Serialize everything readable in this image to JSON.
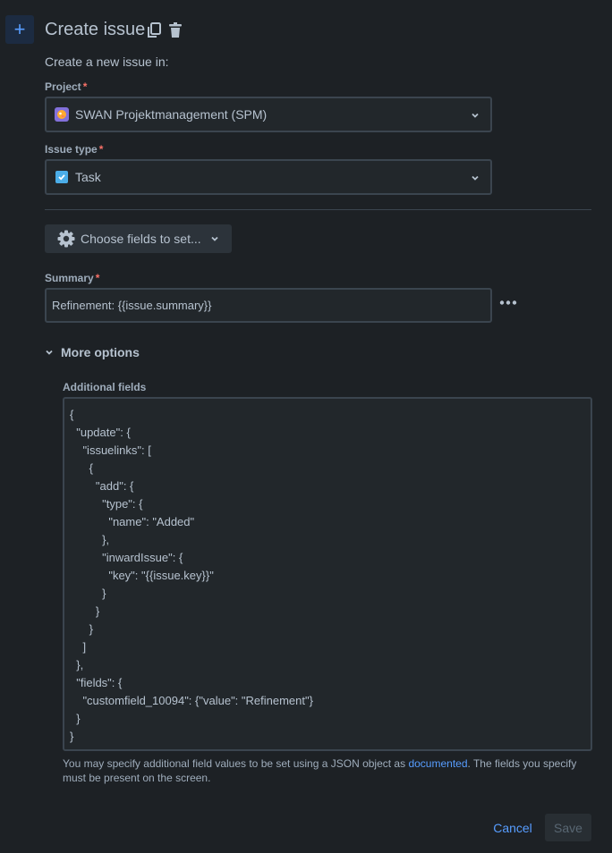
{
  "header": {
    "title": "Create issue",
    "subtitle": "Create a new issue in:"
  },
  "project": {
    "label": "Project",
    "required_marker": "*",
    "value": "SWAN Projektmanagement (SPM)"
  },
  "issue_type": {
    "label": "Issue type",
    "required_marker": "*",
    "value": "Task"
  },
  "choose_fields": {
    "label": "Choose fields to set..."
  },
  "summary": {
    "label": "Summary",
    "required_marker": "*",
    "value": "Refinement: {{issue.summary}}"
  },
  "more_options": {
    "label": "More options"
  },
  "additional_fields": {
    "label": "Additional fields",
    "value": "{\n  \"update\": {\n    \"issuelinks\": [\n      {\n        \"add\": {\n          \"type\": {\n            \"name\": \"Added\"\n          },\n          \"inwardIssue\": {\n            \"key\": \"{{issue.key}}\"\n          }\n        }\n      }\n    ]\n  },\n  \"fields\": {\n    \"customfield_10094\": {\"value\": \"Refinement\"}\n  }\n}",
    "help_before": "You may specify additional field values to be set using a JSON object as ",
    "help_link": "documented",
    "help_after": ". The fields you specify must be present on the screen."
  },
  "footer": {
    "cancel_label": "Cancel",
    "save_label": "Save"
  },
  "colors": {
    "background": "#1d2125",
    "accent": "#579dff",
    "required": "#f87168"
  }
}
